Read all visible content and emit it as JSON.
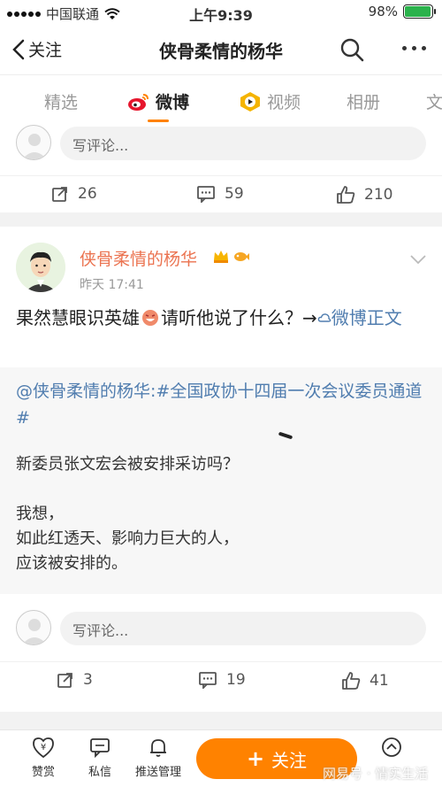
{
  "status_bar": {
    "carrier": "中国联通",
    "time": "上午9:39",
    "battery": "98%",
    "battery_level": 0.98
  },
  "nav": {
    "back_label": "关注",
    "title": "侠骨柔情的杨华"
  },
  "tabs": [
    {
      "label": "精选"
    },
    {
      "label": "微博"
    },
    {
      "label": "视频"
    },
    {
      "label": "相册"
    },
    {
      "label": "文"
    }
  ],
  "card1": {
    "comment_placeholder": "写评论...",
    "reposts": "26",
    "comments": "59",
    "likes": "210"
  },
  "post": {
    "author": "侠骨柔情的杨华",
    "time": "昨天 17:41",
    "text_before": "果然慧眼识英雄",
    "text_after": "请听他说了什么？→",
    "link": "微博正文",
    "repost_head": "@侠骨柔情的杨华:#全国政协十四届一次会议委员通道#",
    "repost_body": "新委员张文宏会被安排采访吗？\n\n我想，\n如此红透天、影响力巨大的人，\n应该被安排的。",
    "comment_placeholder": "写评论...",
    "reposts": "3",
    "comments": "19",
    "likes": "41"
  },
  "bottom_bar": {
    "reward": "赞赏",
    "message": "私信",
    "push_manage": "推送管理",
    "follow": "关注",
    "watermark": "网易号 · 情实生活"
  },
  "colors": {
    "accent": "#ff8200",
    "username": "#eb7350",
    "link": "#507daf"
  }
}
